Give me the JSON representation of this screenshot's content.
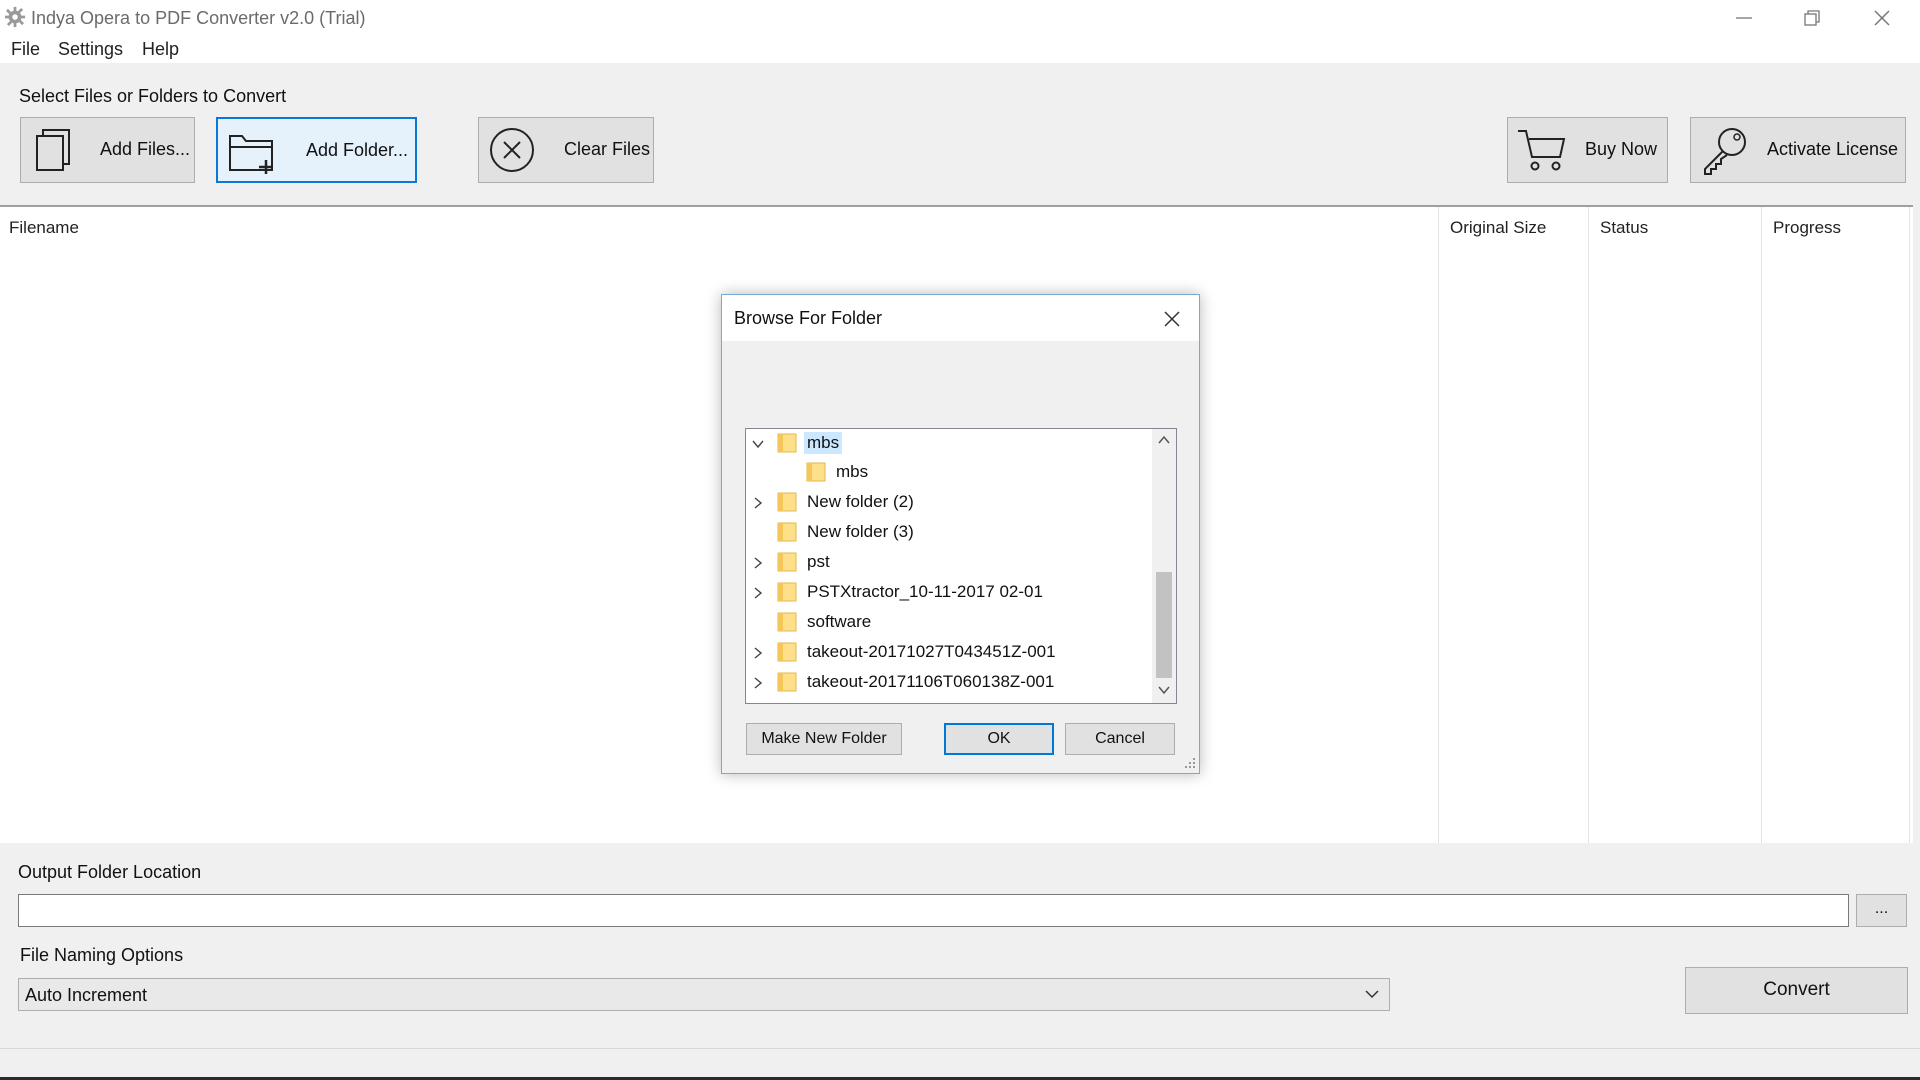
{
  "window": {
    "title": "Indya Opera to PDF Converter v2.0 (Trial)",
    "icon": "gear-icon"
  },
  "menu": {
    "items": [
      "File",
      "Settings",
      "Help"
    ]
  },
  "toolbar": {
    "section_label": "Select Files or Folders to Convert",
    "add_files": "Add Files...",
    "add_folder": "Add Folder...",
    "clear_files": "Clear Files",
    "buy_now": "Buy Now",
    "activate_license": "Activate License"
  },
  "file_list": {
    "columns": [
      "Filename",
      "Original Size",
      "Status",
      "Progress"
    ],
    "rows": []
  },
  "output": {
    "label": "Output Folder Location",
    "path": "",
    "browse_label": "..."
  },
  "naming": {
    "label": "File Naming Options",
    "selected": "Auto Increment"
  },
  "convert_label": "Convert",
  "dialog": {
    "title": "Browse For Folder",
    "tree": [
      {
        "name": "mbs",
        "expander": "expanded",
        "selected": true
      },
      {
        "name": "mbs",
        "expander": "none",
        "selected": false
      },
      {
        "name": "New folder (2)",
        "expander": "collapsed",
        "selected": false
      },
      {
        "name": "New folder (3)",
        "expander": "none",
        "selected": false
      },
      {
        "name": "pst",
        "expander": "collapsed",
        "selected": false
      },
      {
        "name": "PSTXtractor_10-11-2017 02-01",
        "expander": "collapsed",
        "selected": false
      },
      {
        "name": "software",
        "expander": "none",
        "selected": false
      },
      {
        "name": "takeout-20171027T043451Z-001",
        "expander": "collapsed",
        "selected": false
      },
      {
        "name": "takeout-20171106T060138Z-001",
        "expander": "collapsed",
        "selected": false
      }
    ],
    "make_new_folder": "Make New Folder",
    "ok": "OK",
    "cancel": "Cancel"
  },
  "colors": {
    "accent": "#0a78d7",
    "selection": "#cce8ff",
    "folder": "#ffe08a"
  }
}
